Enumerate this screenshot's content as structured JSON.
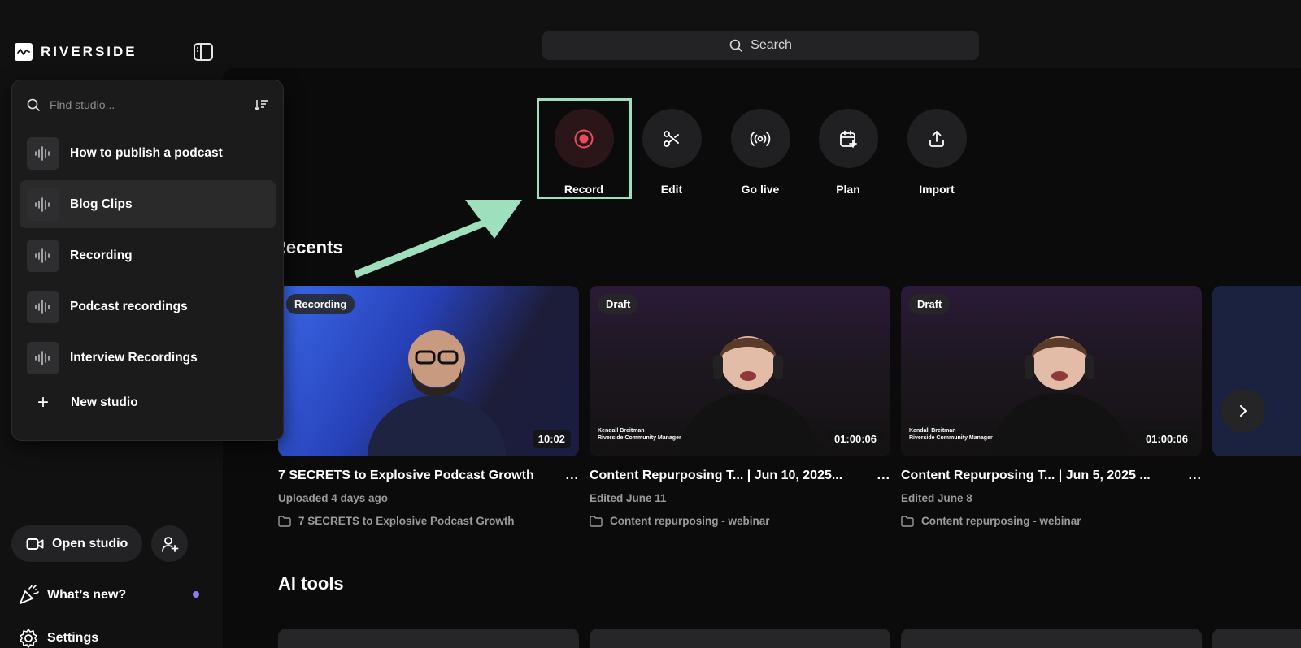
{
  "app": {
    "brand": "RIVERSIDE"
  },
  "search": {
    "label": "Search"
  },
  "studio_picker": {
    "placeholder": "Find studio...",
    "items": [
      {
        "label": "How to publish a podcast",
        "active": false
      },
      {
        "label": "Blog Clips",
        "active": true
      },
      {
        "label": "Recording",
        "active": false
      },
      {
        "label": "Podcast recordings",
        "active": false
      },
      {
        "label": "Interview Recordings",
        "active": false
      }
    ],
    "new_studio": "New studio"
  },
  "sidebar": {
    "open_studio": "Open studio",
    "whats_new": "What’s new?",
    "settings": "Settings"
  },
  "actions": [
    {
      "label": "Record",
      "icon": "record-icon"
    },
    {
      "label": "Edit",
      "icon": "scissors-icon"
    },
    {
      "label": "Go live",
      "icon": "broadcast-icon"
    },
    {
      "label": "Plan",
      "icon": "calendar-plus-icon"
    },
    {
      "label": "Import",
      "icon": "upload-icon"
    }
  ],
  "recents": {
    "title": "Recents",
    "cards": [
      {
        "badge": "Recording",
        "duration": "10:02",
        "title": "7 SECRETS to Explosive Podcast Growth",
        "meta": "Uploaded 4 days ago",
        "folder": "7 SECRETS to Explosive Podcast Growth",
        "caption_name": "",
        "caption_role": ""
      },
      {
        "badge": "Draft",
        "duration": "01:00:06",
        "title": "Content Repurposing T... | Jun 10, 2025...",
        "meta": "Edited June 11",
        "folder": "Content repurposing - webinar",
        "caption_name": "Kendall Breitman",
        "caption_role": "Riverside Community Manager"
      },
      {
        "badge": "Draft",
        "duration": "01:00:06",
        "title": "Content Repurposing T... | Jun 5, 2025 ...",
        "meta": "Edited June 8",
        "folder": "Content repurposing - webinar",
        "caption_name": "Kendall Breitman",
        "caption_role": "Riverside Community Manager"
      }
    ],
    "more_label": "..."
  },
  "ai_tools": {
    "title": "AI tools"
  },
  "colors": {
    "highlight": "#9ee0bd",
    "record_red": "#ea4b5f",
    "accent_dot": "#8d7cf4"
  }
}
